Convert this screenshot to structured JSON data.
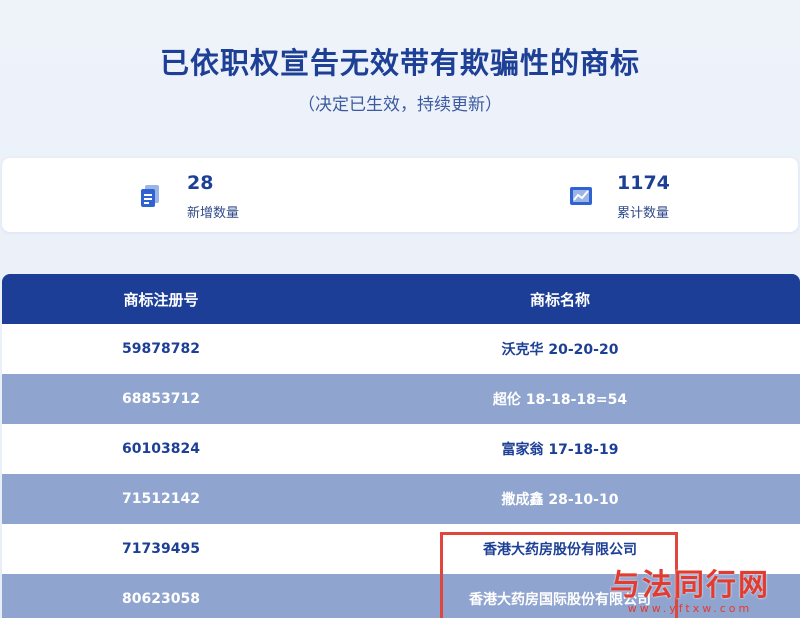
{
  "header": {
    "title": "已依职权宣告无效带有欺骗性的商标",
    "subtitle": "（决定已生效，持续更新）"
  },
  "stats": {
    "new": {
      "value": "28",
      "label": "新增数量",
      "icon": "document-stack-icon"
    },
    "total": {
      "value": "1174",
      "label": "累计数量",
      "icon": "chart-image-icon"
    }
  },
  "table": {
    "headers": [
      "商标注册号",
      "商标名称"
    ],
    "rows": [
      {
        "reg_no": "59878782",
        "name": "沃克华 20-20-20"
      },
      {
        "reg_no": "68853712",
        "name": "超伦 18-18-18=54"
      },
      {
        "reg_no": "60103824",
        "name": "富家翁 17-18-19"
      },
      {
        "reg_no": "71512142",
        "name": "撒成鑫 28-10-10"
      },
      {
        "reg_no": "71739495",
        "name": "香港大药房股份有限公司"
      },
      {
        "reg_no": "80623058",
        "name": "香港大药房国际股份有限公司"
      }
    ]
  },
  "watermark": {
    "main": "与法同行网",
    "sub": "www.yftxw.com"
  },
  "colors": {
    "header_bg": "#1c3e96",
    "even_row_bg": "#8fa4cf",
    "highlight": "#e0473c"
  }
}
